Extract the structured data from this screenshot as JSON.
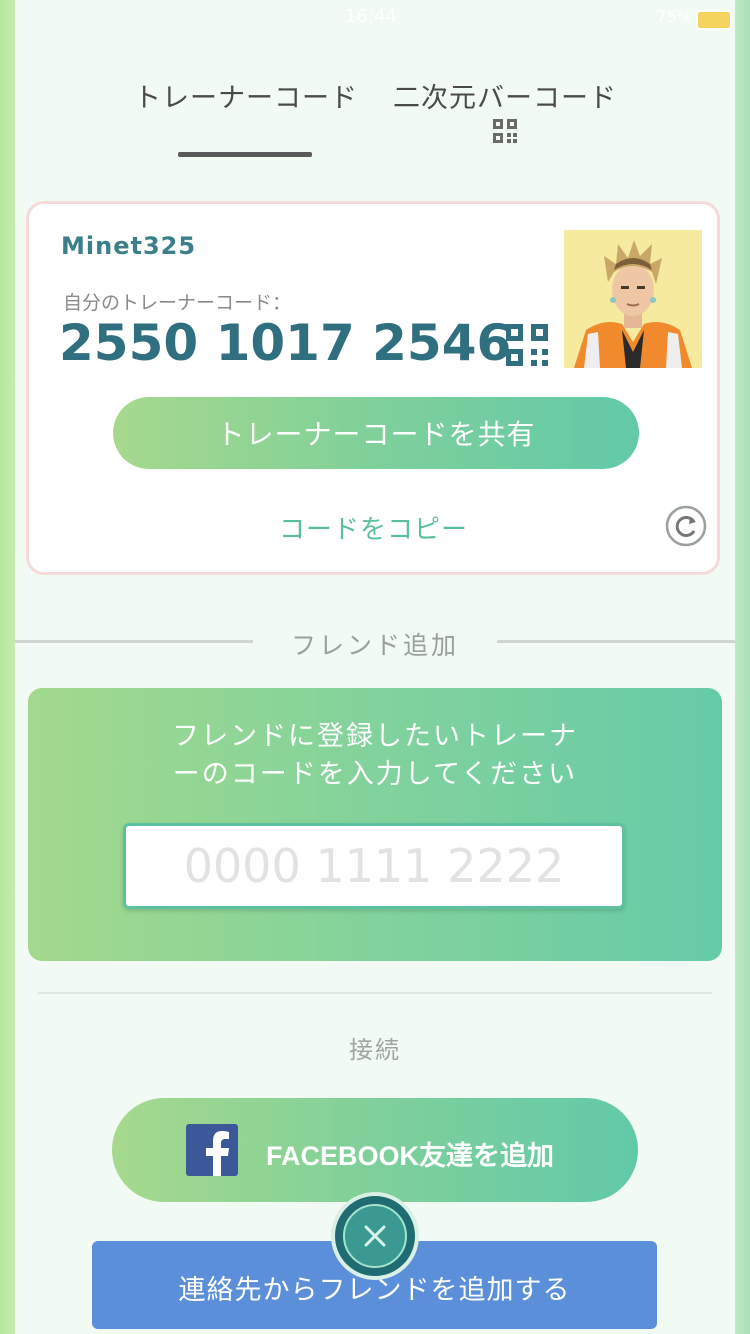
{
  "status_bar": {
    "time": "16:44",
    "battery_percent": "75%"
  },
  "tabs": [
    {
      "label": "トレーナーコード",
      "active": true
    },
    {
      "label": "二次元バーコード",
      "icon": "qr-code-icon"
    }
  ],
  "trainer_card": {
    "username": "Minet325",
    "code_label": "自分のトレーナーコード：",
    "code_value": "2550 1017 2546",
    "share_button": "トレーナーコードを共有",
    "copy_link": "コードをコピー",
    "refresh_icon": "refresh-icon"
  },
  "friend_add": {
    "title": "フレンド追加",
    "prompt_line1": "フレンドに登録したいトレーナ",
    "prompt_line2": "ーのコードを入力してください",
    "input_placeholder": "0000 1111 2222",
    "input_value": ""
  },
  "connect": {
    "title": "接続",
    "facebook_button": "FACEBOOK友達を追加",
    "contacts_button": "連絡先からフレンドを追加する"
  },
  "colors": {
    "accent_green": "#7fd09a",
    "code_teal": "#2f6f7f",
    "contacts_blue": "#5b8fd9",
    "facebook_blue": "#3b5998"
  }
}
